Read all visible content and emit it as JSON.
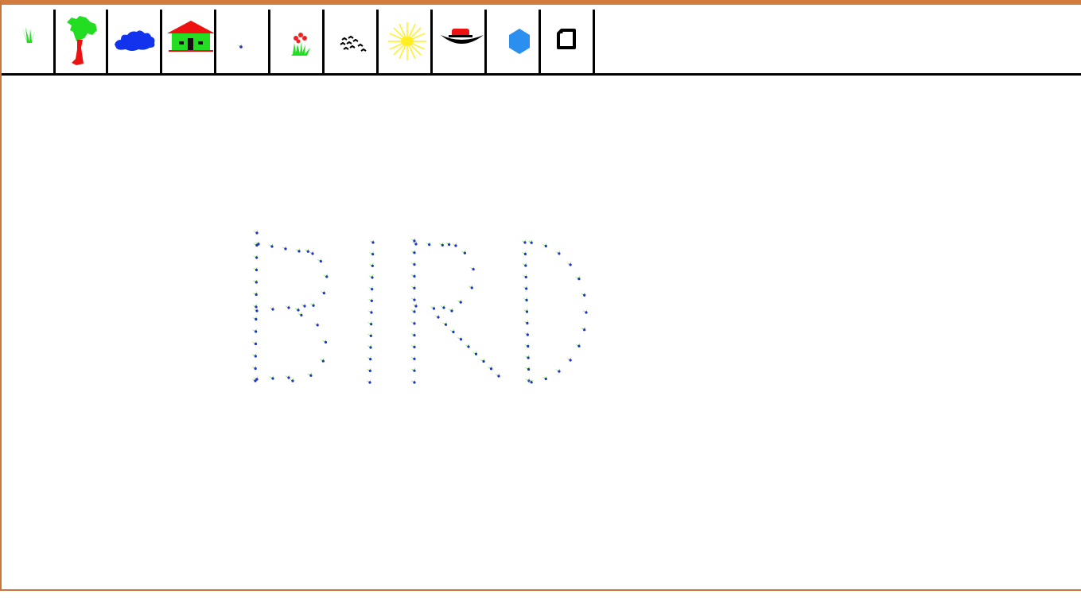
{
  "app": {
    "tools": [
      {
        "icon": "grass-icon",
        "color": "#22dd22"
      },
      {
        "icon": "tree-icon",
        "color": "#ee1111"
      },
      {
        "icon": "cloud-icon",
        "color": "#1133ee"
      },
      {
        "icon": "house-icon",
        "color": "#22dd33"
      },
      {
        "icon": "bird-small-icon",
        "color": "#3377ff"
      },
      {
        "icon": "flowers-icon",
        "color": "#ee2222"
      },
      {
        "icon": "bird-flock-icon",
        "color": "#000000"
      },
      {
        "icon": "sun-icon",
        "color": "#ffee22"
      },
      {
        "icon": "boat-icon",
        "color": "#ee1111"
      },
      {
        "icon": "hexagon-icon",
        "color": "#2a8fee"
      },
      {
        "icon": "eraser-icon",
        "color": "#000000"
      }
    ],
    "frame_color": "#d27d3f"
  },
  "canvas": {
    "stamp": "bird-small-icon",
    "drawn_word": "BIRD",
    "stamp_colors": {
      "wing": "#66dd22",
      "body": "#1a33cc"
    }
  }
}
